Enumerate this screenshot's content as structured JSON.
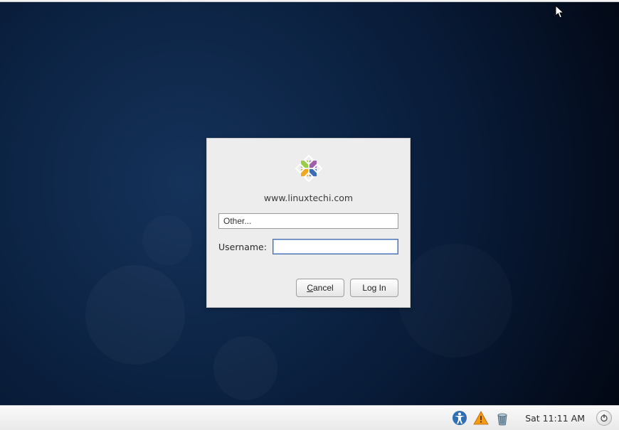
{
  "login": {
    "hostname": "www.linuxtechi.com",
    "user_selector_value": "Other...",
    "username_label": "Username:",
    "username_value": "",
    "cancel_label_prefix": "C",
    "cancel_label_rest": "ancel",
    "login_label": "Log In"
  },
  "panel": {
    "clock": "Sat 11:11 AM"
  },
  "icons": {
    "accessibility": "accessibility-icon",
    "warning": "warning-icon",
    "trash": "trash-icon",
    "power": "power-icon"
  }
}
